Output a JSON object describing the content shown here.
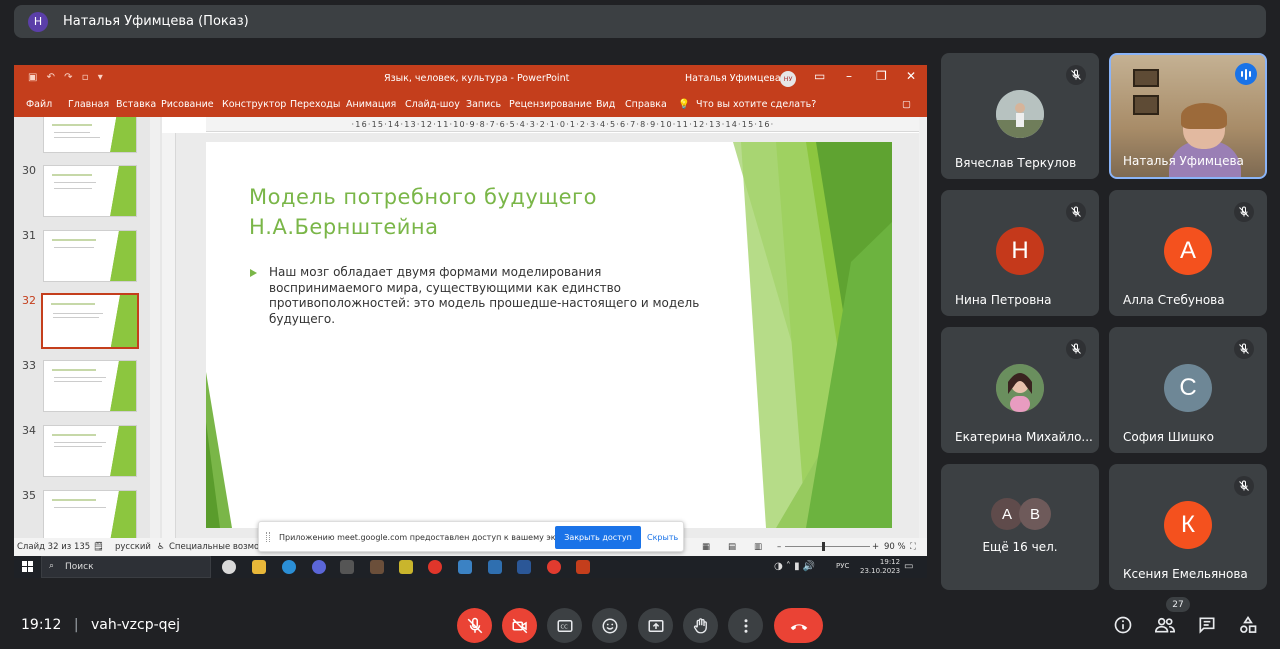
{
  "presenter_bar": {
    "avatar_letter": "Н",
    "title": "Наталья Уфимцева (Показ)"
  },
  "powerpoint": {
    "window_title": "Язык, человек, культура  -  PowerPoint",
    "user_name": "Наталья Уфимцева",
    "user_initials": "НУ",
    "ribbon_tabs": [
      "Файл",
      "Главная",
      "Вставка",
      "Рисование",
      "Конструктор",
      "Переходы",
      "Анимация",
      "Слайд-шоу",
      "Запись",
      "Рецензирование",
      "Вид",
      "Справка"
    ],
    "tell_me": "Что вы хотите сделать?",
    "thumb_numbers": [
      "30",
      "31",
      "32",
      "33",
      "34",
      "35"
    ],
    "current_slide_number": "32",
    "ruler": "·16·15·14·13·12·11·10·9·8·7·6·5·4·3·2·1·0·1·2·3·4·5·6·7·8·9·10·11·12·13·14·15·16·",
    "slide": {
      "title_line1": "Модель потребного  будущего",
      "title_line2": "Н.А.Бернштейна",
      "bullet": "Наш мозг обладает двумя формами моделирования воспринимаемого мира, существующими как единство противоположностей: это модель прошедше-настоящего и модель будущего."
    },
    "status": {
      "slide_count": "Слайд 32 из 135",
      "language": "русский",
      "accessibility": "Специальные возмож",
      "zoom": "90 %"
    },
    "share_notice": {
      "message": "Приложению meet.google.com предоставлен доступ к вашему экрану.",
      "stop_button": "Закрыть доступ",
      "hide": "Скрыть"
    },
    "taskbar": {
      "search": "Поиск",
      "lang": "РУС",
      "time": "19:12",
      "date": "23.10.2023"
    }
  },
  "participants": [
    {
      "name": "Вячеслав Теркулов",
      "type": "photo",
      "muted": true
    },
    {
      "name": "Наталья Уфимцева",
      "type": "video",
      "speaking": true
    },
    {
      "name": "Нина Петровна",
      "letter": "Н",
      "color": "#c5391b",
      "muted": true
    },
    {
      "name": "Алла Стебунова",
      "letter": "А",
      "color": "#f4511e",
      "muted": true
    },
    {
      "name": "Екатерина Михайло...",
      "type": "photo",
      "muted": true
    },
    {
      "name": "София Шишко",
      "letter": "С",
      "color": "#6e8796",
      "muted": true
    },
    {
      "name": "Ещё 16 чел.",
      "letters": [
        "А",
        "В"
      ]
    },
    {
      "name": "Ксения Емельянова",
      "letter": "К",
      "color": "#f4511e",
      "muted": true
    }
  ],
  "bottom_bar": {
    "time": "19:12",
    "separator": "|",
    "meeting_code": "vah-vzcp-qej",
    "participant_count": "27"
  },
  "colors": {
    "ppt_accent": "#c43e1c",
    "slide_green": "#7ab648",
    "meet_bg": "#202124",
    "tile_bg": "#3c4043",
    "danger": "#ea4335"
  }
}
